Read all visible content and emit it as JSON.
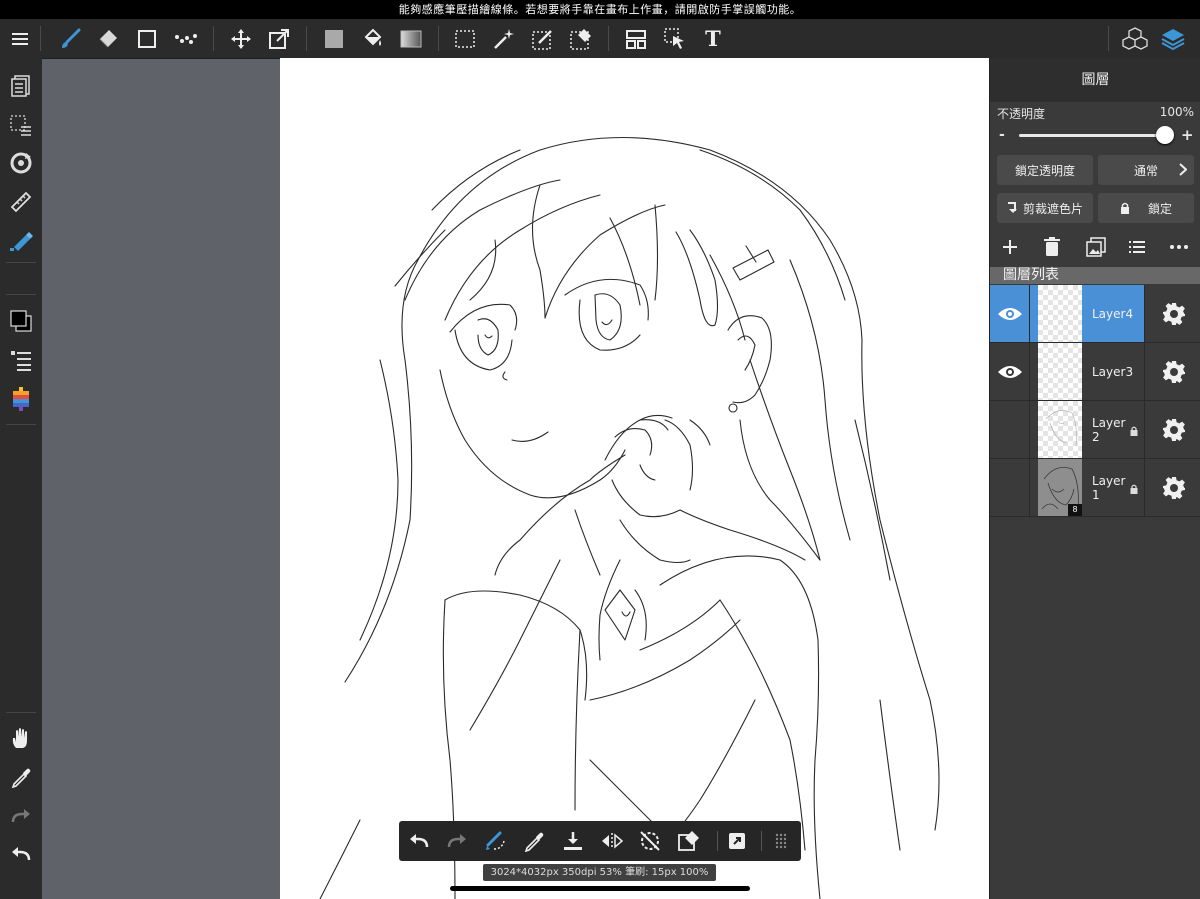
{
  "status_bar": {
    "message": "能夠感應筆壓描繪線條。若想要將手靠在畫布上作畫，請開啟防手掌誤觸功能。"
  },
  "toolbar": {
    "tools": [
      "menu-icon",
      "brush-icon",
      "eraser-icon",
      "rectangle-icon",
      "dot-brush-icon",
      "move-icon",
      "transform-icon",
      "fill-color-icon",
      "bucket-icon",
      "gradient-icon",
      "select-rect-icon",
      "magic-wand-icon",
      "select-pen-icon",
      "select-eraser-icon",
      "layout-icon",
      "select-layer-icon",
      "text-icon",
      "materials-icon",
      "layers-icon"
    ],
    "text_tool_label": "T"
  },
  "leftbar": {
    "tools": [
      "layer-list-icon",
      "selection-list-icon",
      "rotate-icon",
      "ruler-icon",
      "pen-settings-icon",
      "color-icon",
      "brush-list-icon",
      "color-palette-icon",
      "hand-icon",
      "eyedropper-icon",
      "redo-icon",
      "undo-icon"
    ]
  },
  "layer_panel": {
    "title": "圖層",
    "opacity_label": "不透明度",
    "opacity_value": "100%",
    "opacity_fraction": 1.0,
    "minus_label": "-",
    "plus_label": "+",
    "lock_alpha_label": "鎖定透明度",
    "blend_mode_label": "通常",
    "clipping_label": "剪裁遮色片",
    "lock_label": "鎖定",
    "list_header": "圖層列表",
    "layers": [
      {
        "name": "Layer4",
        "visible": true,
        "selected": true,
        "locked": false
      },
      {
        "name": "Layer3",
        "visible": true,
        "selected": false,
        "locked": false
      },
      {
        "name": "Layer\n2",
        "visible": false,
        "selected": false,
        "locked": true
      },
      {
        "name": "Layer\n1",
        "visible": false,
        "selected": false,
        "locked": true,
        "badge": "8"
      }
    ]
  },
  "bottom_bar": {
    "tools": [
      "undo-icon",
      "redo-icon",
      "stabilizer-icon",
      "eyedropper-icon",
      "save-icon",
      "flip-icon",
      "rotate-reset-icon",
      "eraser-toggle-icon",
      "share-icon",
      "grip-icon"
    ]
  },
  "info": {
    "text": "3024*4032px 350dpi 53% 筆刷: 15px 100%"
  },
  "colors": {
    "accent": "#3d96d6",
    "panel": "#3a3a3a",
    "toolbar": "#2b2b2b",
    "background": "#5f6369"
  }
}
